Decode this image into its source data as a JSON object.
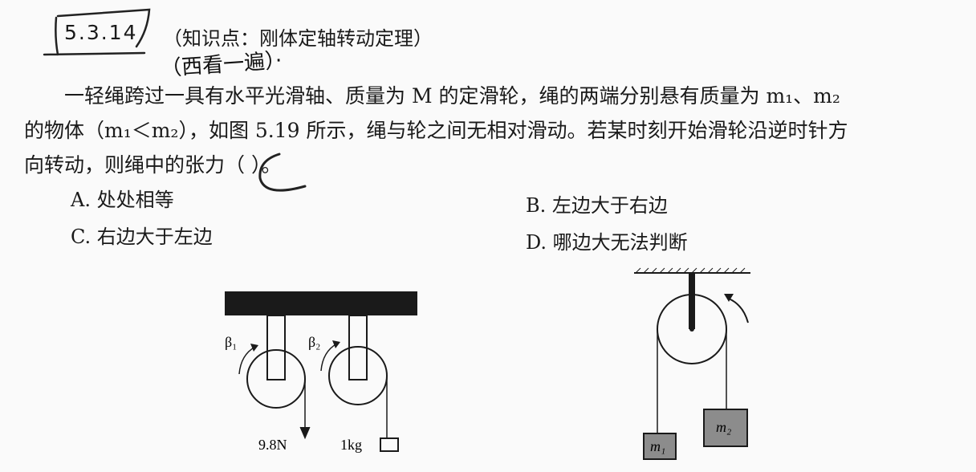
{
  "question": {
    "number": "5.3.14",
    "topic": "（知识点：刚体定轴转动定理）",
    "handwritten_note": "（西看一遍）·",
    "stem_lines": [
      "一轻绳跨过一具有水平光滑轴、质量为 M 的定滑轮，绳的两端分别悬有质量为 m₁、m₂",
      "的物体（m₁＜m₂），如图 5.19 所示，绳与轮之间无相对滑动。若某时刻开始滑轮沿逆时针方",
      "向转动，则绳中的张力（        ）。"
    ],
    "handwritten_answer": "C",
    "options": [
      {
        "label": "A.",
        "text": "处处相等"
      },
      {
        "label": "B.",
        "text": "左边大于右边"
      },
      {
        "label": "C.",
        "text": "右边大于左边"
      },
      {
        "label": "D.",
        "text": "哪边大无法判断"
      }
    ]
  },
  "figure_left": {
    "beta1": "β₁",
    "beta2": "β₂",
    "force_label": "9.8N",
    "mass_label": "1kg"
  },
  "figure_right": {
    "m1": "m₁",
    "m2": "m₂"
  },
  "colors": {
    "ink": "#1a1a1a",
    "block_fill": "#8c8c8c",
    "paper": "#fafafa"
  }
}
